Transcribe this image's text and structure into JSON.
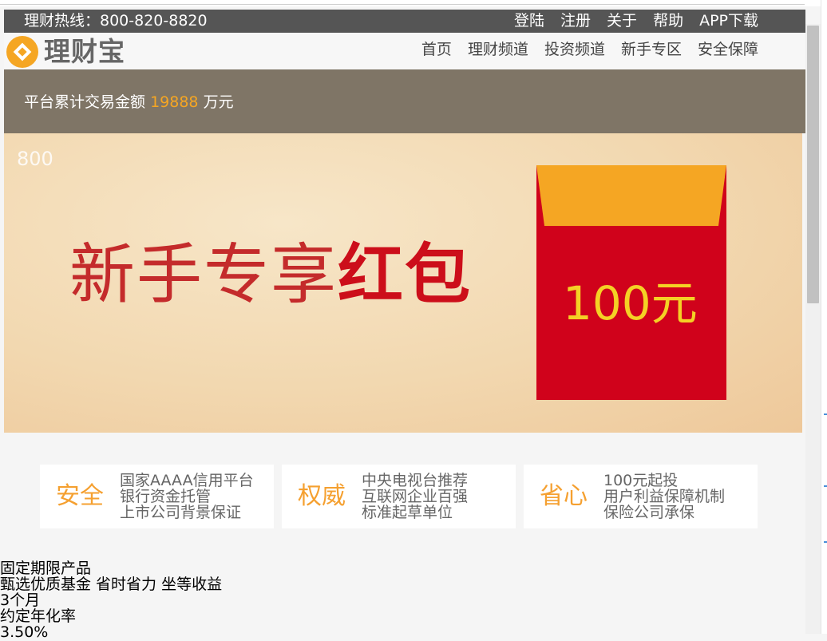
{
  "topbar": {
    "hotline": "理财热线：800-820-8820",
    "links": [
      "登陆",
      "注册",
      "关于",
      "帮助",
      "APP下载"
    ]
  },
  "header": {
    "logo_text": "理财宝",
    "nav": [
      "首页",
      "理财频道",
      "投资频道",
      "新手专区",
      "安全保障"
    ]
  },
  "stats": {
    "prefix": "平台累计交易金额",
    "amount": "19888",
    "suffix": "万元"
  },
  "banner": {
    "tag": "800",
    "headline_light": "新手专享",
    "headline_strong": "红包",
    "envelope_amount": "100元"
  },
  "features": [
    {
      "title": "安全",
      "lines": [
        "国家AAAA信用平台",
        "银行资金托管",
        "上市公司背景保证"
      ]
    },
    {
      "title": "权威",
      "lines": [
        "中央电视台推荐",
        "互联网企业百强",
        "标准起草单位"
      ]
    },
    {
      "title": "省心",
      "lines": [
        "100元起投",
        "用户利益保障机制",
        "保险公司承保"
      ]
    }
  ],
  "product": {
    "category": "固定期限产品",
    "slogan": "甄选优质基金 省时省力 坐等收益",
    "term": "3个月",
    "rate_label": "约定年化率",
    "rate_value": "3.50%"
  },
  "colors": {
    "topbar_bg": "#555555",
    "stats_bg": "#7f7566",
    "accent_orange": "#f5a623",
    "envelope_red": "#d0021b",
    "envelope_flap": "#f5a623",
    "headline_red": "#cc0e1a"
  }
}
